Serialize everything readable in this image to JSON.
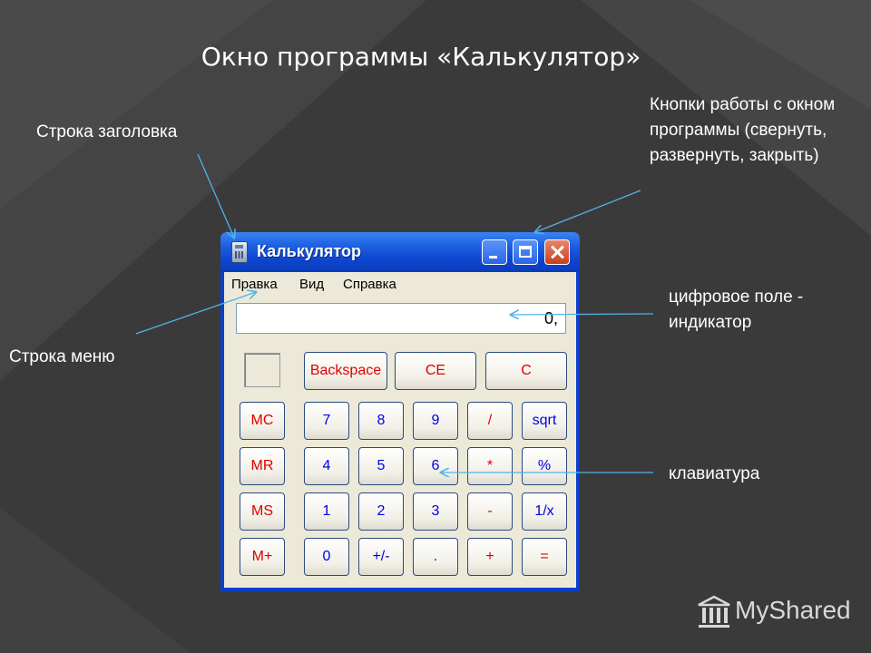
{
  "slide": {
    "title": "Окно программы «Калькулятор»",
    "callouts": {
      "title_bar": "Строка заголовка",
      "menu_bar": "Строка меню",
      "window_buttons": "Кнопки работы с окном программы (свернуть, развернуть, закрыть)",
      "display": "цифровое поле - индикатор",
      "keypad": "клавиатура"
    },
    "logo_text": "MyShared"
  },
  "window": {
    "title": "Калькулятор",
    "menu": [
      "Правка",
      "Вид",
      "Справка"
    ],
    "display_value": "0,",
    "keys": {
      "backspace": "Backspace",
      "ce": "CE",
      "c": "C",
      "mc": "MC",
      "mr": "MR",
      "ms": "MS",
      "mplus": "M+",
      "k7": "7",
      "k8": "8",
      "k9": "9",
      "div": "/",
      "sqrt": "sqrt",
      "k4": "4",
      "k5": "5",
      "k6": "6",
      "mul": "*",
      "pct": "%",
      "k1": "1",
      "k2": "2",
      "k3": "3",
      "sub": "-",
      "inv": "1/x",
      "k0": "0",
      "sign": "+/-",
      "dot": ".",
      "add": "+",
      "eq": "="
    }
  },
  "colors": {
    "background": "#3a3a3a",
    "title_bar": "#0d45cf",
    "annotation_line": "#4fb3e6",
    "key_red": "#e00000",
    "key_blue": "#0000e8"
  }
}
